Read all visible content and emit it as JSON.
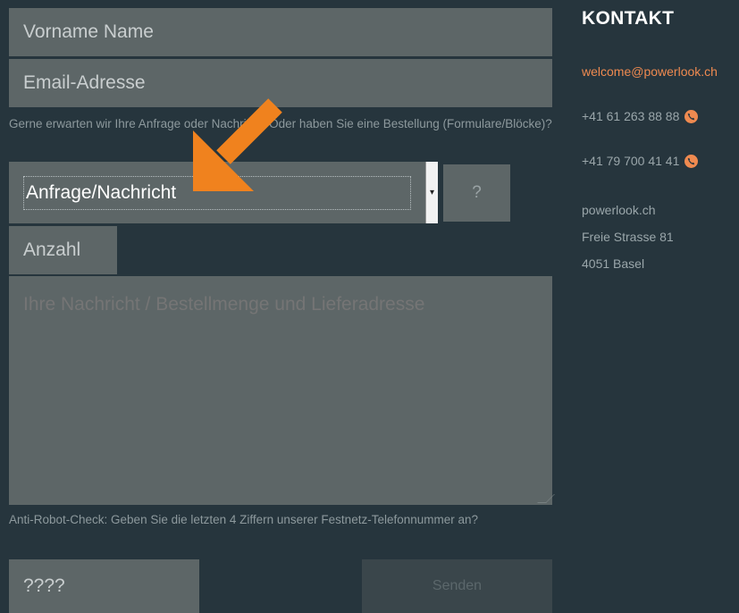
{
  "form": {
    "name_placeholder": "Vorname Name",
    "email_placeholder": "Email-Adresse",
    "hint_request": "Gerne erwarten wir Ihre Anfrage oder Nachricht. Oder haben Sie eine Bestellung (Formulare/Blöcke)?",
    "select_value": "Anfrage/Nachricht",
    "help_label": "?",
    "quantity_placeholder": "Anzahl",
    "message_placeholder": "Ihre Nachricht / Bestellmenge und Lieferadresse",
    "anti_robot_hint": "Anti-Robot-Check:   Geben Sie die letzten 4 Ziffern unserer Festnetz-Telefonnummer an?",
    "robot_placeholder": "????",
    "send_label": "Senden"
  },
  "kontakt": {
    "title": "KONTAKT",
    "email": "welcome@powerlook.ch",
    "phone1": "+41 61 263 88 88",
    "phone2": "+41 79 700 41 41",
    "address_line1": "powerlook.ch",
    "address_line2": "Freie Strasse 81",
    "address_line3": "4051 Basel"
  },
  "colors": {
    "background": "#26353d",
    "field": "#5d6667",
    "accent": "#ef8a50",
    "arrow": "#f0821e"
  },
  "icons": {
    "phone": "phone-icon",
    "select_arrow": "select-arrow-icon",
    "annotation": "orange-arrow-icon"
  }
}
